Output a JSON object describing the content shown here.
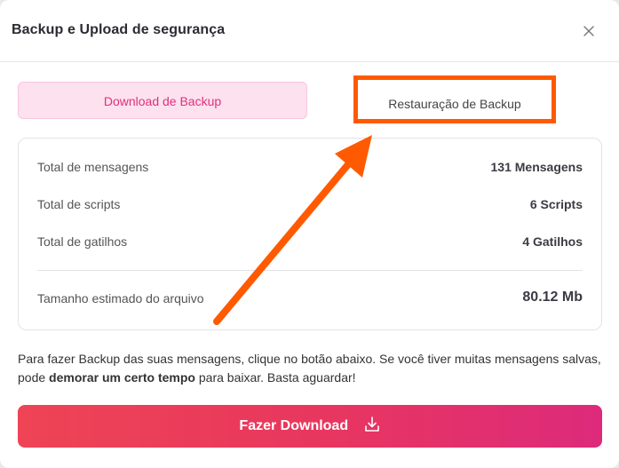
{
  "dialog": {
    "title": "Backup e Upload de segurança"
  },
  "tabs": {
    "download": "Download de Backup",
    "restore": "Restauração de Backup"
  },
  "stats": {
    "messages": {
      "label": "Total de mensagens",
      "value": "131 Mensagens"
    },
    "scripts": {
      "label": "Total de scripts",
      "value": "6 Scripts"
    },
    "triggers": {
      "label": "Total de gatilhos",
      "value": "4 Gatilhos"
    },
    "size": {
      "label": "Tamanho estimado do arquivo",
      "value": "80.12 Mb"
    }
  },
  "note": {
    "part1": "Para fazer Backup das suas mensagens, clique no botão abaixo. Se você tiver muitas mensagens salvas, pode ",
    "bold": "demorar um certo tempo",
    "part2": " para baixar. Basta aguardar!"
  },
  "button": {
    "download_label": "Fazer Download"
  },
  "icons": {
    "close": "close-icon",
    "download": "download-icon"
  },
  "colors": {
    "accent_pink": "#e0307d",
    "highlight_orange": "#ff5a00"
  }
}
